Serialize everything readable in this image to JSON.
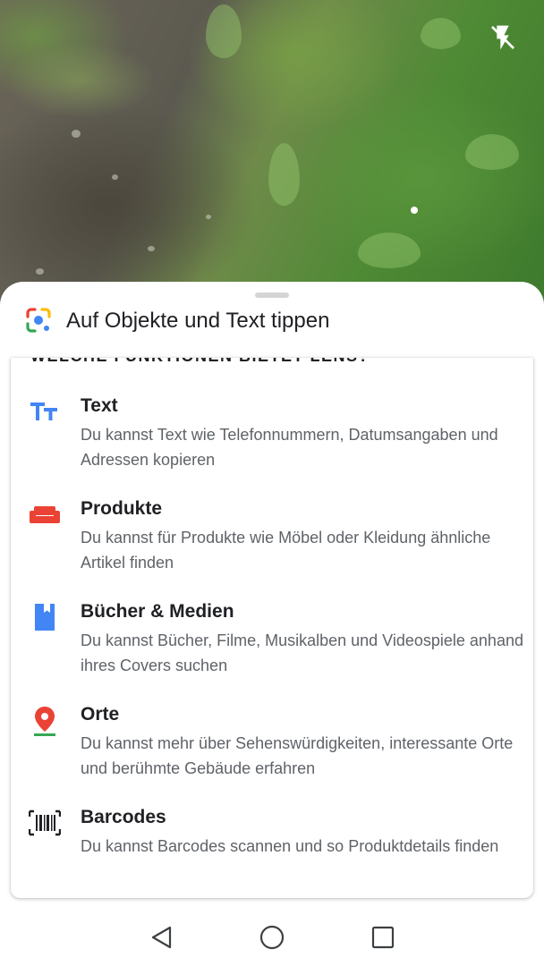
{
  "camera": {
    "flash_icon": "flash-off-icon"
  },
  "sheet": {
    "app_icon": "google-lens-icon",
    "title": "Auf Objekte und Text tippen",
    "section_heading": "WELCHE FUNKTIONEN BIETET LENS?"
  },
  "features": [
    {
      "icon": "text-icon",
      "title": "Text",
      "description": "Du kannst Text wie Telefonnummern, Datumsangaben und Adressen kopieren"
    },
    {
      "icon": "sofa-icon",
      "title": "Produkte",
      "description": "Du kannst für Produkte wie Möbel oder Kleidung ähnliche Artikel finden"
    },
    {
      "icon": "book-icon",
      "title": "Bücher & Medien",
      "description": "Du kannst Bücher, Filme, Musikalben und Videospiele anhand ihres Covers suchen"
    },
    {
      "icon": "place-pin-icon",
      "title": "Orte",
      "description": "Du kannst mehr über Sehenswürdigkeiten, interessante Orte und berühmte Gebäude erfahren"
    },
    {
      "icon": "barcode-icon",
      "title": "Barcodes",
      "description": "Du kannst Barcodes scannen und so Produktdetails finden"
    }
  ],
  "colors": {
    "blue": "#4285f4",
    "red": "#ea4335",
    "yellow": "#fbbc04",
    "green": "#34a853",
    "text_primary": "#202124",
    "text_secondary": "#5f6368"
  },
  "navbar": {
    "back_icon": "back-triangle-icon",
    "home_icon": "home-circle-icon",
    "recents_icon": "recents-square-icon"
  }
}
